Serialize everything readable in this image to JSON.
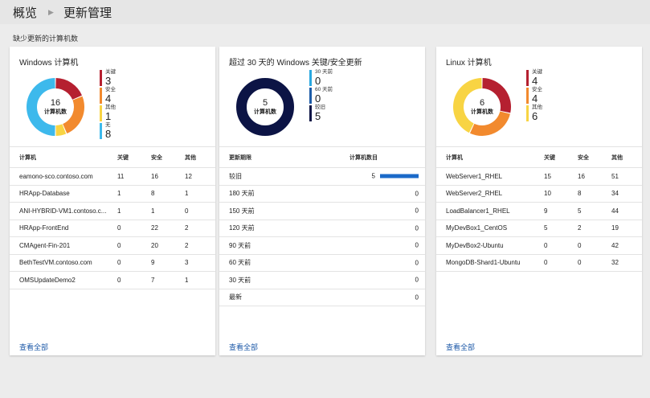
{
  "breadcrumb": {
    "overview": "概览",
    "current": "更新管理"
  },
  "section_label": "缺少更新的计算机数",
  "colors": {
    "critical": "#b52030",
    "security": "#f28a2e",
    "other": "#f8d443",
    "none": "#3db9ec",
    "t30": "#29a8e0",
    "t60": "#1d5ca8",
    "older": "#0c1445",
    "bar": "#1b6ac9"
  },
  "windows": {
    "title": "Windows 计算机",
    "donut": {
      "count": "16",
      "caption": "计算机数",
      "values": [
        3,
        4,
        1,
        8
      ]
    },
    "legend": [
      {
        "label": "关键",
        "value": "3",
        "color_key": "critical"
      },
      {
        "label": "安全",
        "value": "4",
        "color_key": "security"
      },
      {
        "label": "其他",
        "value": "1",
        "color_key": "other"
      },
      {
        "label": "无",
        "value": "8",
        "color_key": "none"
      }
    ],
    "columns": [
      "计算机",
      "关键",
      "安全",
      "其他"
    ],
    "rows": [
      [
        "eamono-sco.contoso.com",
        "11",
        "16",
        "12"
      ],
      [
        "HRApp-Database",
        "1",
        "8",
        "1"
      ],
      [
        "ANI-HYBRID-VM1.contoso.c...",
        "1",
        "1",
        "0"
      ],
      [
        "HRApp-FrontEnd",
        "0",
        "22",
        "2"
      ],
      [
        "CMAgent-Fin-201",
        "0",
        "20",
        "2"
      ],
      [
        "BethTestVM.contoso.com",
        "0",
        "9",
        "3"
      ],
      [
        "OMSUpdateDemo2",
        "0",
        "7",
        "1"
      ]
    ],
    "view_all": "查看全部"
  },
  "aging": {
    "title": "超过 30 天的 Windows 关键/安全更新",
    "donut": {
      "count": "5",
      "caption": "计算机数",
      "values": [
        0,
        0,
        5
      ]
    },
    "legend": [
      {
        "label": "30 天前",
        "value": "0",
        "color_key": "t30"
      },
      {
        "label": "60 天前",
        "value": "0",
        "color_key": "t60"
      },
      {
        "label": "较旧",
        "value": "5",
        "color_key": "older"
      }
    ],
    "columns": [
      "更新期限",
      "计算机数目"
    ],
    "rows": [
      {
        "label": "较旧",
        "value": "5",
        "bar": 1
      },
      {
        "label": "180 天前",
        "value": "0",
        "bar": 0
      },
      {
        "label": "150 天前",
        "value": "0",
        "bar": 0
      },
      {
        "label": "120 天前",
        "value": "0",
        "bar": 0
      },
      {
        "label": "90 天前",
        "value": "0",
        "bar": 0
      },
      {
        "label": "60 天前",
        "value": "0",
        "bar": 0
      },
      {
        "label": "30 天前",
        "value": "0",
        "bar": 0
      },
      {
        "label": "最新",
        "value": "0",
        "bar": 0
      }
    ],
    "view_all": "查看全部"
  },
  "linux": {
    "title": "Linux 计算机",
    "donut": {
      "count": "6",
      "caption": "计算机数",
      "values": [
        4,
        4,
        6
      ]
    },
    "legend": [
      {
        "label": "关键",
        "value": "4",
        "color_key": "critical"
      },
      {
        "label": "安全",
        "value": "4",
        "color_key": "security"
      },
      {
        "label": "其他",
        "value": "6",
        "color_key": "other"
      }
    ],
    "columns": [
      "计算机",
      "关键",
      "安全",
      "其他"
    ],
    "rows": [
      [
        "WebServer1_RHEL",
        "15",
        "16",
        "51"
      ],
      [
        "WebServer2_RHEL",
        "10",
        "8",
        "34"
      ],
      [
        "LoadBalancer1_RHEL",
        "9",
        "5",
        "44"
      ],
      [
        "MyDevBox1_CentOS",
        "5",
        "2",
        "19"
      ],
      [
        "MyDevBox2-Ubuntu",
        "0",
        "0",
        "42"
      ],
      [
        "MongoDB-Shard1-Ubuntu",
        "0",
        "0",
        "32"
      ]
    ],
    "view_all": "查看全部"
  }
}
